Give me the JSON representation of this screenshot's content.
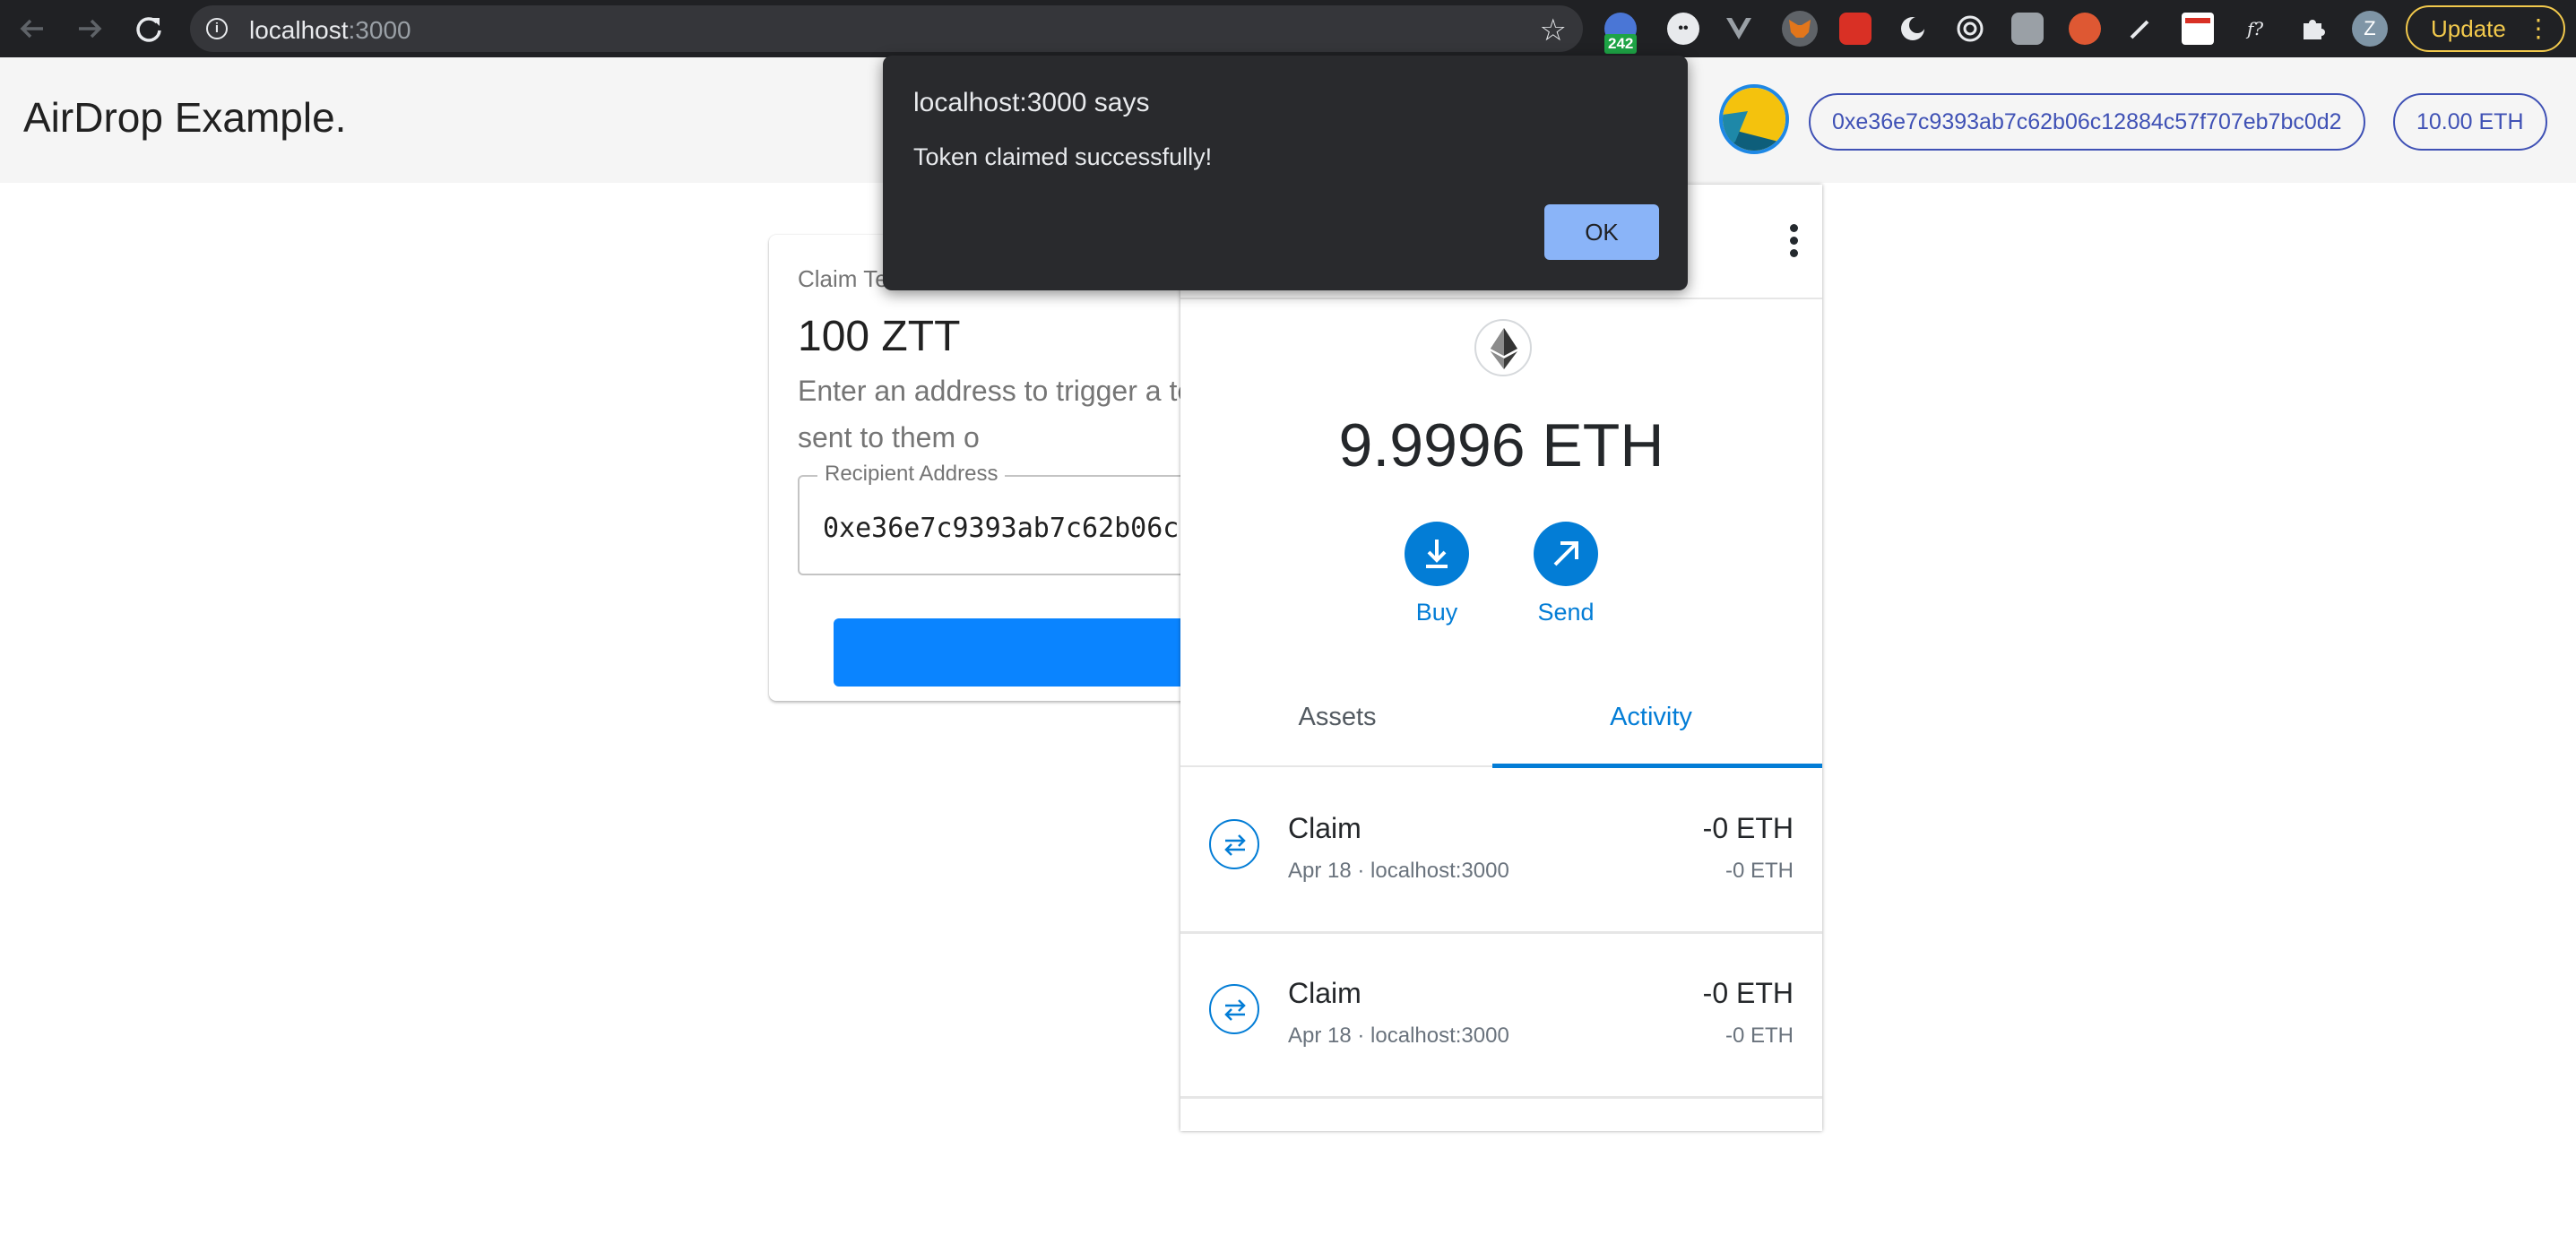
{
  "browser": {
    "url_host": "localhost",
    "url_port": ":3000",
    "extension_badge": "242",
    "profile_initial": "Z",
    "update_label": "Update",
    "icons": [
      "back-icon",
      "forward-icon",
      "reload-icon",
      "info-icon",
      "bookmark-star-icon",
      "extensions-puzzle-icon",
      "more-vert-icon"
    ],
    "accent_color": "#f2c94c"
  },
  "app": {
    "title": "AirDrop Example.",
    "account_address": "0xe36e7c9393ab7c62b06c12884c57f707eb7bc0d2",
    "account_balance": "10.00 ETH",
    "accent_color": "#3f51b5"
  },
  "claim_card": {
    "overline": "Claim Test Token",
    "amount": "100 ZTT",
    "description": "Enter an address to trigger a test token it will be sent to them o",
    "field_label": "Recipient Address",
    "field_value": "0xe36e7c9393ab7c62b06c12884c57f707eb7bc0d2",
    "button_color": "#0a84ff"
  },
  "metamask": {
    "balance": "9.9996 ETH",
    "actions": [
      {
        "label": "Buy",
        "icon": "download-icon"
      },
      {
        "label": "Send",
        "icon": "send-arrow-icon"
      }
    ],
    "tabs": [
      {
        "label": "Assets",
        "active": false
      },
      {
        "label": "Activity",
        "active": true
      }
    ],
    "activity": [
      {
        "title": "Claim",
        "subtitle": "Apr 18 · localhost:3000",
        "amount": "-0 ETH",
        "amount_secondary": "-0 ETH"
      },
      {
        "title": "Claim",
        "subtitle": "Apr 18 · localhost:3000",
        "amount": "-0 ETH",
        "amount_secondary": "-0 ETH"
      }
    ],
    "accent_color": "#037dd6"
  },
  "dialog": {
    "title": "localhost:3000 says",
    "message": "Token claimed successfully!",
    "ok_label": "OK"
  }
}
